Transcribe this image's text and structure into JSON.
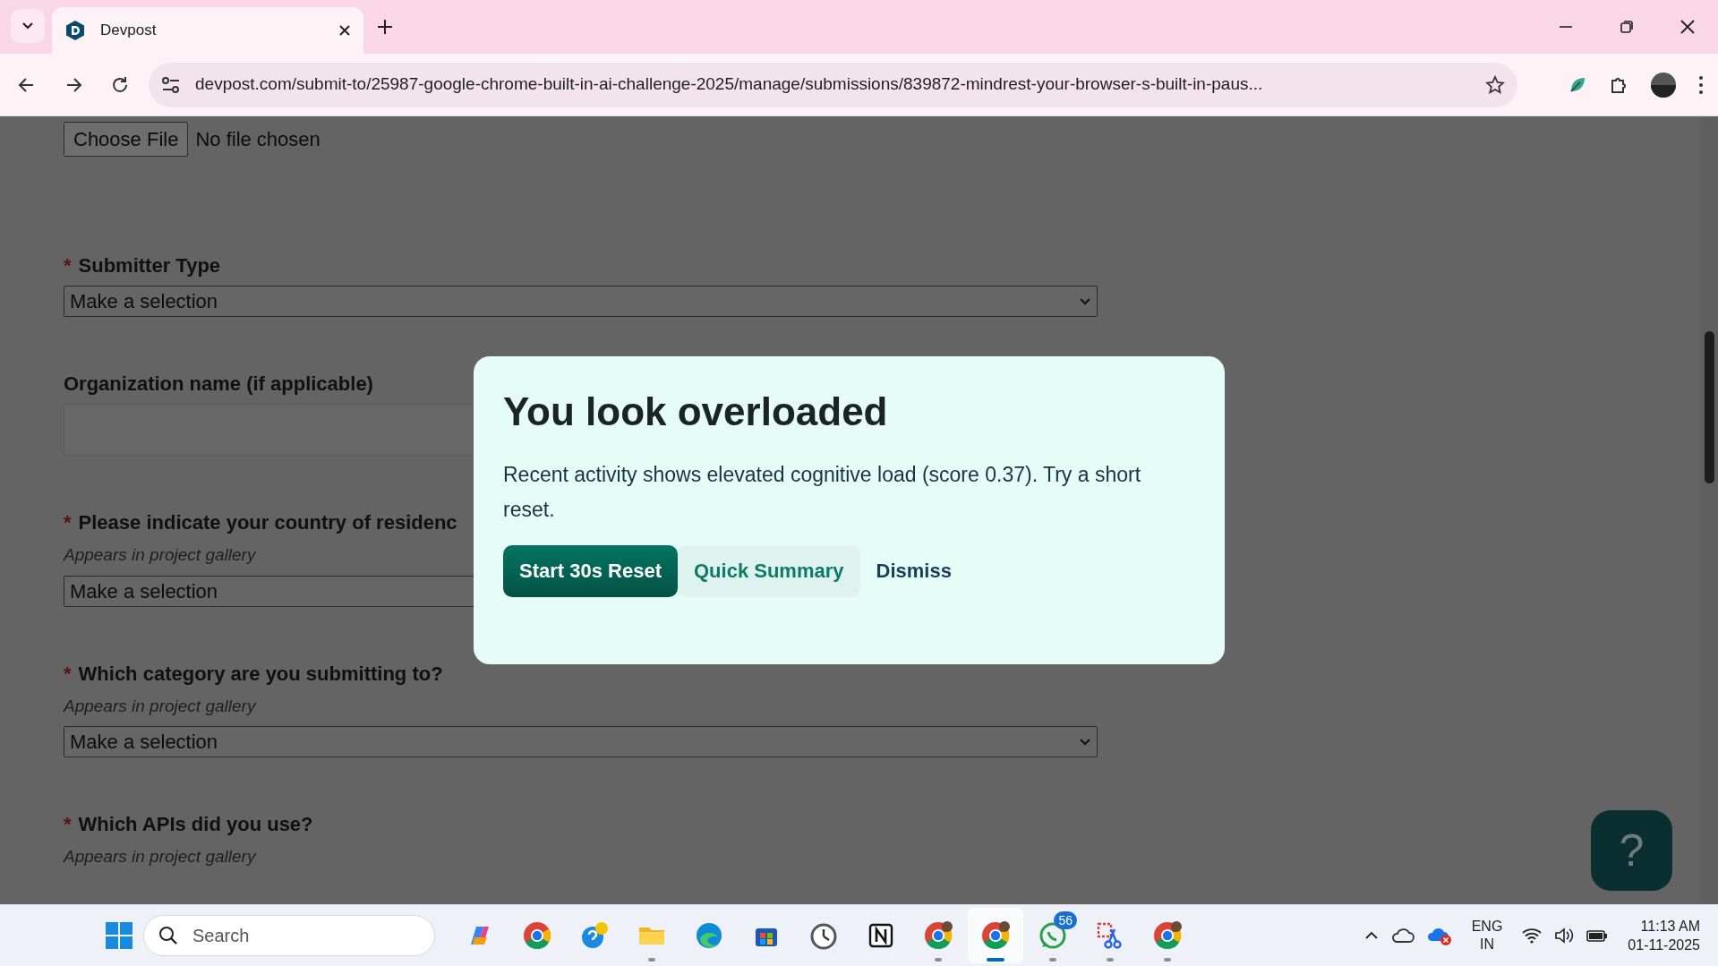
{
  "browser": {
    "tab": {
      "title": "Devpost"
    },
    "url": "devpost.com/submit-to/25987-google-chrome-built-in-ai-challenge-2025/manage/submissions/839872-mindrest-your-browser-s-built-in-paus..."
  },
  "form": {
    "file_input": {
      "button": "Choose File",
      "status": "No file chosen"
    },
    "fields": [
      {
        "kind": "select",
        "marker": "*",
        "label": "Submitter Type",
        "value": "Make a selection"
      },
      {
        "kind": "text",
        "label": "Organization name (if applicable)"
      },
      {
        "kind": "select",
        "marker": "*",
        "label": "Please indicate your country of residenc",
        "hint": "Appears in project gallery",
        "value": "Make a selection"
      },
      {
        "kind": "select",
        "marker": "*",
        "label": "Which category are you submitting to?",
        "hint": "Appears in project gallery",
        "value": "Make a selection"
      },
      {
        "kind": "select",
        "marker": "*",
        "label": "Which APIs did you use?",
        "hint": "Appears in project gallery"
      }
    ]
  },
  "modal": {
    "title": "You look overloaded",
    "message": "Recent activity shows elevated cognitive load (score 0.37). Try a short reset.",
    "buttons": [
      {
        "label": "Start 30s Reset",
        "kind": "primary"
      },
      {
        "label": "Quick Summary",
        "kind": "secondary"
      },
      {
        "label": "Dismiss",
        "kind": "link"
      }
    ]
  },
  "help_button": {
    "label": "?"
  },
  "taskbar": {
    "search_placeholder": "Search",
    "apps": [
      {
        "kind": "copilot",
        "running": false,
        "selected": false
      },
      {
        "kind": "chrome",
        "running": false,
        "selected": false
      },
      {
        "kind": "help",
        "running": false,
        "selected": false
      },
      {
        "kind": "folder",
        "running": true,
        "selected": false
      },
      {
        "kind": "edge",
        "running": false,
        "selected": false
      },
      {
        "kind": "store",
        "running": false,
        "selected": false
      },
      {
        "kind": "clock",
        "running": false,
        "selected": false
      },
      {
        "kind": "notion",
        "running": false,
        "selected": false
      },
      {
        "kind": "chrome-profile",
        "running": true,
        "selected": false
      },
      {
        "kind": "chrome-profile",
        "running": true,
        "selected": true
      },
      {
        "kind": "whatsapp",
        "running": true,
        "selected": false,
        "badge": "56"
      },
      {
        "kind": "snip",
        "running": true,
        "selected": false
      },
      {
        "kind": "chrome-profile",
        "running": true,
        "selected": false
      }
    ],
    "language": "ENG",
    "region": "IN",
    "time": "11:13 AM",
    "date": "01-11-2025"
  }
}
